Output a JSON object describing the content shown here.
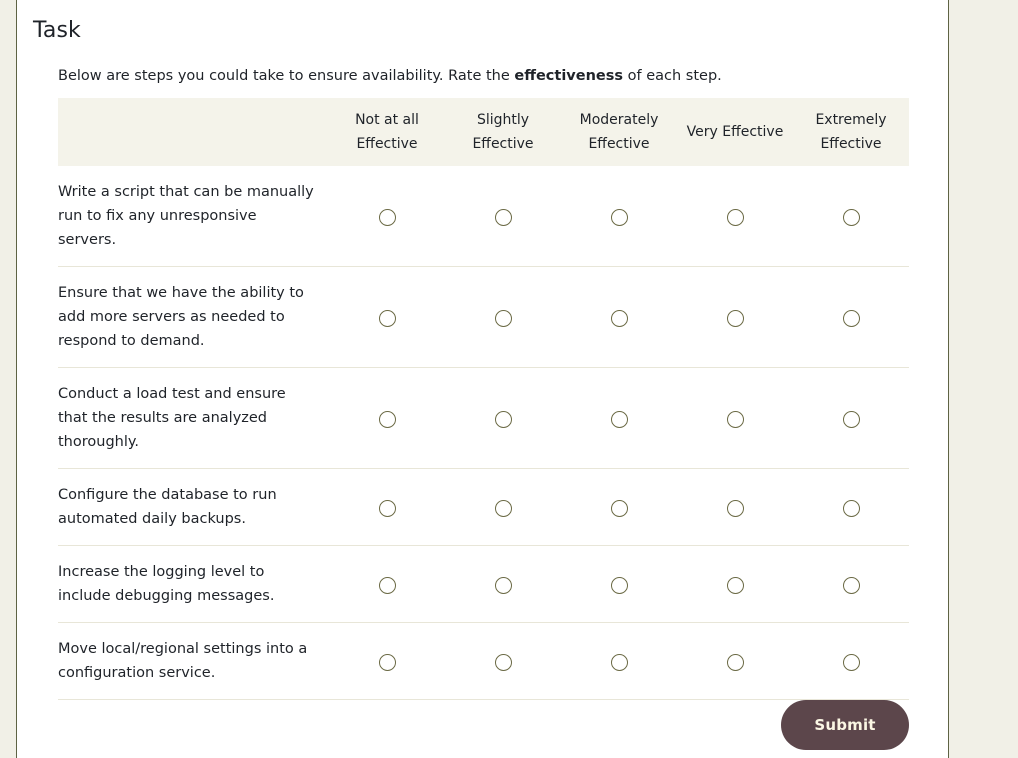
{
  "page": {
    "title": "Task",
    "instruction_prefix": "Below are steps you could take to ensure availability. Rate the ",
    "instruction_emphasis": "effectiveness",
    "instruction_suffix": " of each step."
  },
  "colors": {
    "page_background": "#f1f0e7",
    "panel_background": "#ffffff",
    "panel_border": "#5e6344",
    "header_row_background": "#f4f3ea",
    "row_divider": "#e8e6d8",
    "radio_border": "#6b6a45",
    "submit_background": "#5c464b",
    "submit_text": "#fbf7e4",
    "text": "#1f2329"
  },
  "matrix": {
    "statement_column_header": "",
    "scale": [
      "Not at all Effective",
      "Slightly Effective",
      "Moderately Effective",
      "Very Effective",
      "Extremely Effective"
    ],
    "rows": [
      {
        "statement": "Write a script that can be manually run to fix any unresponsive servers.",
        "selected": null
      },
      {
        "statement": "Ensure that we have the ability to add more servers as needed to respond to demand.",
        "selected": null
      },
      {
        "statement": "Conduct a load test and ensure that the results are analyzed thoroughly.",
        "selected": null
      },
      {
        "statement": "Configure the database to run automated daily backups.",
        "selected": null
      },
      {
        "statement": "Increase the logging level to include debugging messages.",
        "selected": null
      },
      {
        "statement": "Move local/regional settings into a configuration service.",
        "selected": null
      }
    ]
  },
  "footer": {
    "submit_label": "Submit"
  }
}
